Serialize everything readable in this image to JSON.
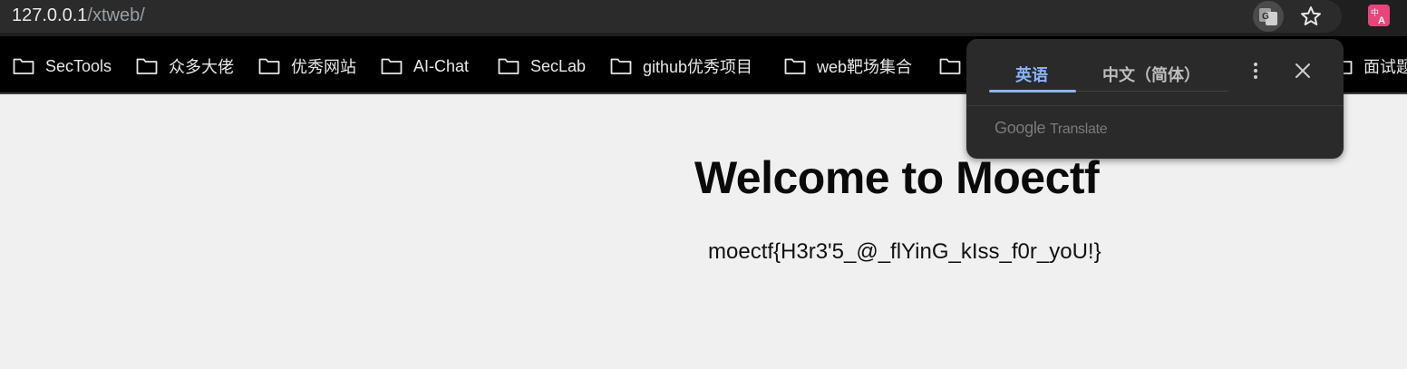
{
  "address_bar": {
    "url_host": "127.0.0.1",
    "url_path": "/xtweb/",
    "translate_icon": "google-translate-icon",
    "bookmark_icon": "star-icon",
    "extension_icon": "translate-extension-icon"
  },
  "bookmarks": [
    {
      "label": "SecTools"
    },
    {
      "label": "众多大佬"
    },
    {
      "label": "优秀网站"
    },
    {
      "label": "AI-Chat"
    },
    {
      "label": "SecLab"
    },
    {
      "label": "github优秀项目"
    },
    {
      "label": "web靶场集合"
    },
    {
      "label": "面试题"
    }
  ],
  "translate_popup": {
    "tab_source": "英语",
    "tab_target": "中文（简体）",
    "branding_google": "Google",
    "branding_translate": "Translate"
  },
  "page": {
    "title": "Welcome to Moectf",
    "flag": "moectf{H3r3'5_@_flYinG_kIss_f0r_yoU!}"
  },
  "colors": {
    "accent": "#8ab4f8",
    "background": "#f0f0f0",
    "toolbar": "#1f1f1f"
  }
}
